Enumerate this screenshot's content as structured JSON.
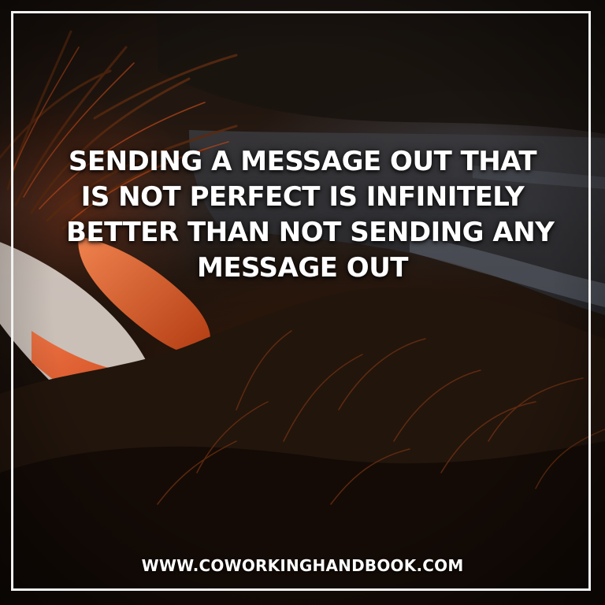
{
  "quote": {
    "lines": [
      "SENDING A MESSAGE OUT THAT",
      "IS NOT PERFECT IS INFINITELY",
      "BETTER THAN NOT SENDING ANY",
      "MESSAGE OUT"
    ]
  },
  "footer": {
    "website": "WWW.COWORKINGHANDBOOK.COM"
  },
  "colors": {
    "text": "#ffffff",
    "border": "#f2f2f2",
    "accent_sunset": "#e2511c"
  }
}
